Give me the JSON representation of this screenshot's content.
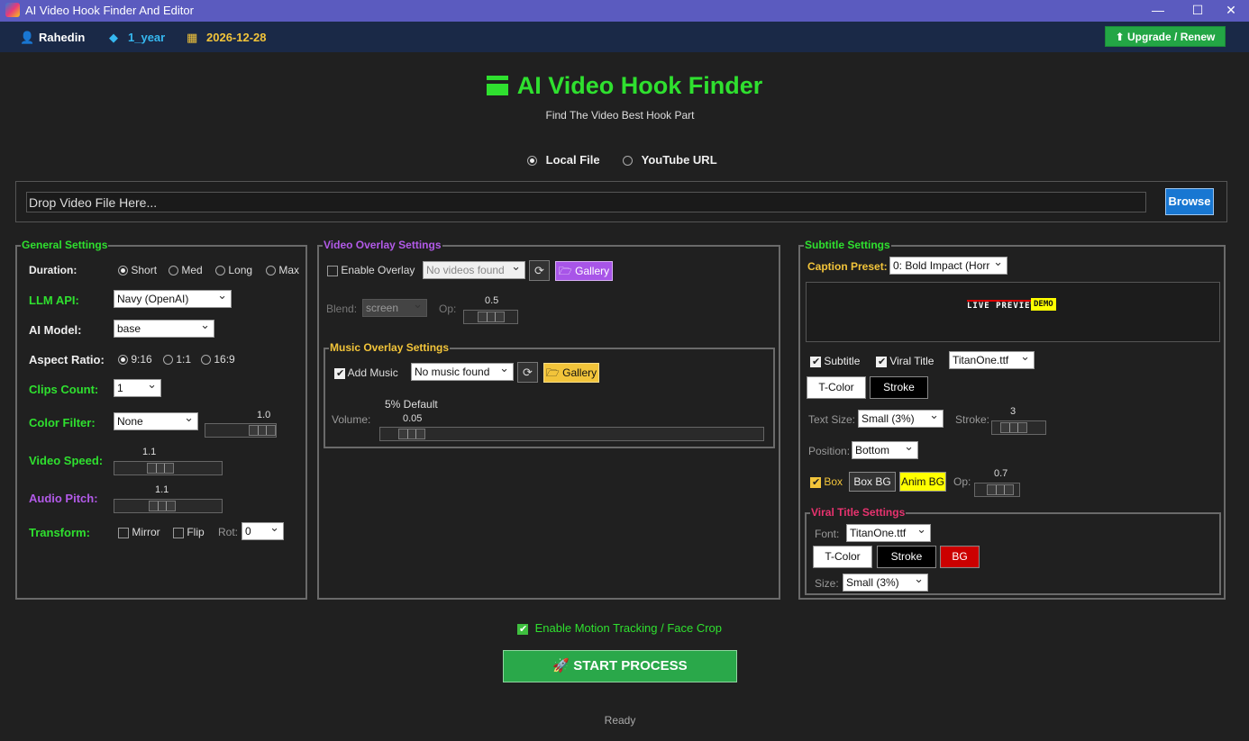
{
  "window": {
    "title": "AI Video Hook Finder And Editor"
  },
  "user": {
    "name": "Rahedin",
    "plan": "1_year",
    "expiry": "2026-12-28",
    "upgrade": "⬆ Upgrade / Renew"
  },
  "header": {
    "title": "AI Video Hook Finder",
    "subtitle": "Find The Video Best Hook Part"
  },
  "source": {
    "local": "Local File",
    "youtube": "YouTube URL",
    "drop_text": "Drop Video File Here...",
    "browse": "Browse"
  },
  "general": {
    "title": "General Settings",
    "duration_label": "Duration:",
    "durations": [
      "Short",
      "Med",
      "Long",
      "Max"
    ],
    "llm_label": "LLM API:",
    "llm_value": "Navy (OpenAI)",
    "model_label": "AI Model:",
    "model_value": "base",
    "aspect_label": "Aspect Ratio:",
    "aspects": [
      "9:16",
      "1:1",
      "16:9"
    ],
    "clips_label": "Clips Count:",
    "clips_value": "1",
    "color_label": "Color Filter:",
    "color_value": "None",
    "color_slider": "1.0",
    "color_slider_level": 1.0,
    "speed_label": "Video Speed:",
    "speed_value": "1.1",
    "speed_level": 1.1,
    "pitch_label": "Audio Pitch:",
    "pitch_value": "1.1",
    "pitch_level": 1.1,
    "transform_label": "Transform:",
    "mirror": "Mirror",
    "flip": "Flip",
    "rot_label": "Rot:",
    "rot_value": "0"
  },
  "video_overlay": {
    "title": "Video Overlay Settings",
    "enable": "Enable Overlay",
    "videos": "No videos found",
    "gallery": "Gallery",
    "blend_label": "Blend:",
    "blend_value": "screen",
    "op_label": "Op:",
    "op_value": "0.5",
    "op_level": 0.5
  },
  "music_overlay": {
    "title": "Music Overlay Settings",
    "add": "Add Music",
    "music": "No music found",
    "gallery": "Gallery",
    "default_label": "5% Default",
    "volume_label": "Volume:",
    "volume_value": "0.05",
    "volume_level": 0.05
  },
  "subtitle": {
    "title": "Subtitle Settings",
    "preset_label": "Caption Preset:",
    "preset_value": "0: Bold Impact (Horr",
    "preview_text": "LIVE PREVIEW",
    "preview_demo": "DEMO",
    "subtitle_chk": "Subtitle",
    "viral_chk": "Viral Title",
    "font_value": "TitanOne.ttf",
    "tcolor": "T-Color",
    "stroke": "Stroke",
    "textsize_label": "Text Size:",
    "textsize_value": "Small (3%)",
    "stroke_label": "Stroke:",
    "stroke_value": "3",
    "stroke_level": 3,
    "position_label": "Position:",
    "position_value": "Bottom",
    "box": "Box",
    "boxbg": "Box BG",
    "animbg": "Anim BG",
    "op_label": "Op:",
    "op_value": "0.7",
    "op_level": 0.7
  },
  "viral": {
    "title": "Viral Title Settings",
    "font_label": "Font:",
    "font_value": "TitanOne.ttf",
    "tcolor": "T-Color",
    "stroke": "Stroke",
    "bg": "BG",
    "size_label": "Size:",
    "size_value": "Small (3%)"
  },
  "footer": {
    "motion": "Enable Motion Tracking / Face Crop",
    "start": "START PROCESS",
    "status": "Ready"
  },
  "colors": {
    "accent_green": "#2fe02f",
    "purple": "#b25ae8",
    "gold": "#f2c43a",
    "pink": "#e8336f",
    "blue": "#1877d2"
  }
}
